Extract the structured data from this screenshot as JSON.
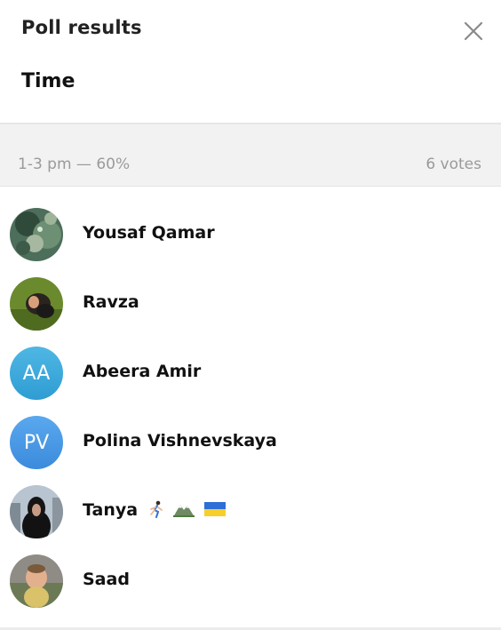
{
  "header": {
    "title": "Poll results",
    "question": "Time",
    "close_icon": "close-icon"
  },
  "option": {
    "label": "1-3 pm — 60%",
    "votes": "6 votes"
  },
  "voters": [
    {
      "name": "Yousaf Qamar",
      "avatar": "photo"
    },
    {
      "name": "Ravza",
      "avatar": "photo"
    },
    {
      "name": "Abeera Amir",
      "initials": "AA",
      "color": "#39a8d8"
    },
    {
      "name": "Polina Vishnevskaya",
      "initials": "PV",
      "color": "#4a98e0"
    },
    {
      "name": "Tanya",
      "avatar": "photo",
      "emojis": [
        "runner-icon",
        "mountain-icon",
        "ukraine-flag-icon"
      ]
    },
    {
      "name": "Saad",
      "avatar": "photo"
    }
  ]
}
